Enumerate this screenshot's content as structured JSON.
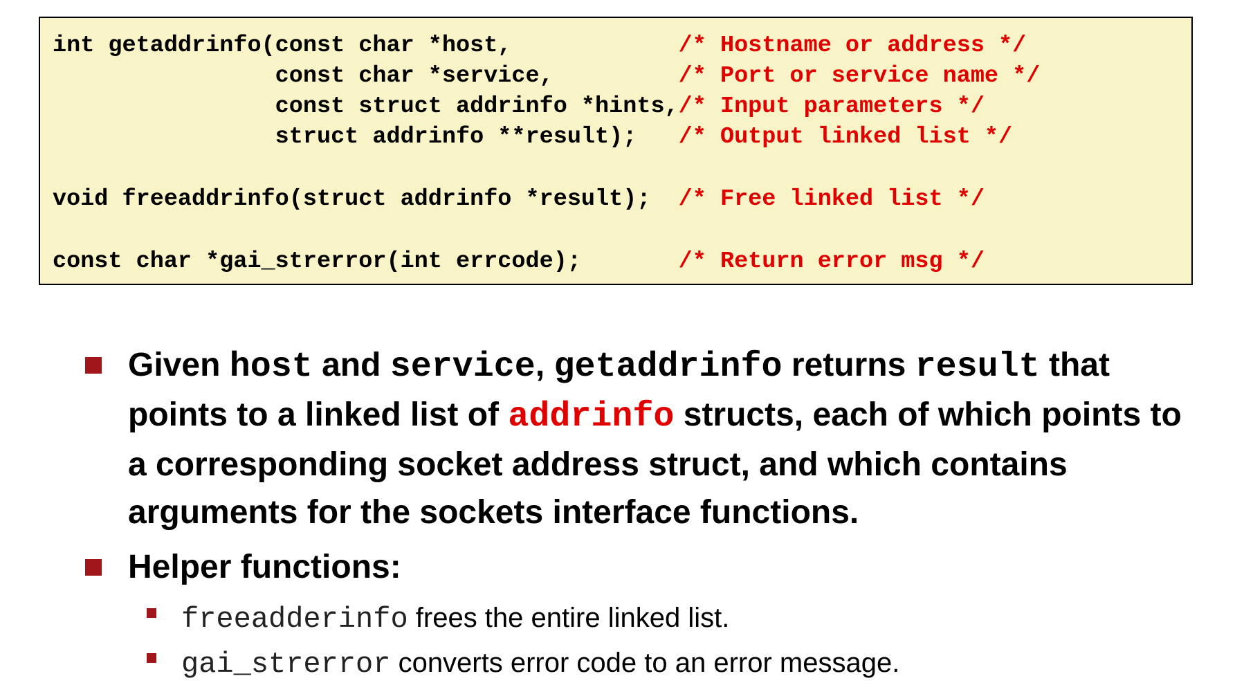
{
  "code": {
    "lines": [
      {
        "code": "int getaddrinfo(const char *host,            ",
        "comment": "/* Hostname or address */"
      },
      {
        "code": "                const char *service,         ",
        "comment": "/* Port or service name */"
      },
      {
        "code": "                const struct addrinfo *hints,",
        "comment": "/* Input parameters */"
      },
      {
        "code": "                struct addrinfo **result);   ",
        "comment": "/* Output linked list */"
      },
      {
        "code": "void freeaddrinfo(struct addrinfo *result);  ",
        "comment": "/* Free linked list */"
      },
      {
        "code": "const char *gai_strerror(int errcode);       ",
        "comment": "/* Return error msg */"
      }
    ]
  },
  "bullet1": {
    "t1": "Given ",
    "c1": "host",
    "t2": " and ",
    "c2": "service",
    "t3": ", ",
    "c3": "getaddrinfo",
    "t4": "  returns ",
    "c4": "result",
    "t5": " that points to a linked list of ",
    "c5": "addrinfo",
    "t6": " structs, each of which points to a corresponding socket address struct, and which contains arguments for the sockets interface functions."
  },
  "bullet2": {
    "label": "Helper functions:"
  },
  "sub_items": [
    {
      "code": "freeadderinfo",
      "text": " frees the entire linked list."
    },
    {
      "code": "gai_strerror",
      "text": " converts error code to an error message."
    }
  ],
  "colors": {
    "code_background": "#f8f4c8",
    "comment": "#e00000",
    "bullet": "#a0161a"
  }
}
